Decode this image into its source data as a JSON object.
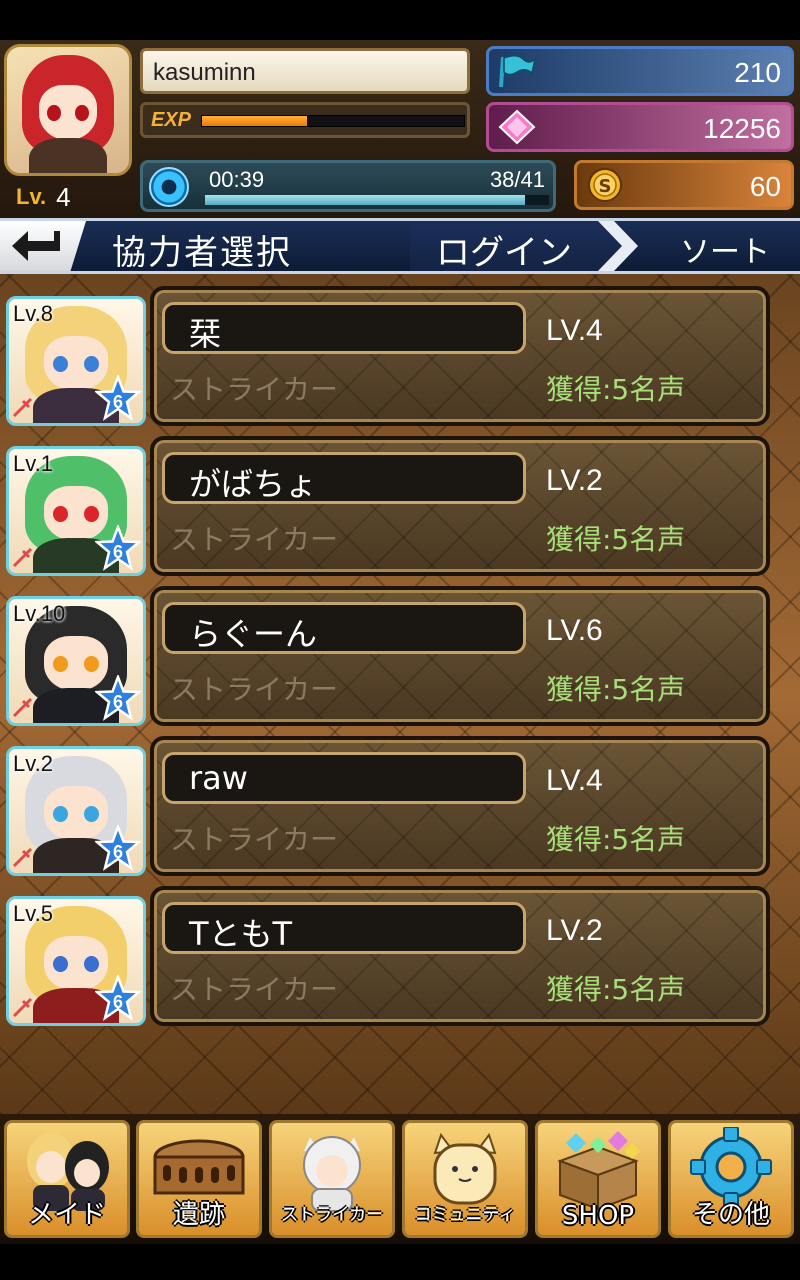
{
  "player": {
    "name": "kasuminn",
    "level_label": "Lv.",
    "level": "4",
    "exp_label": "EXP",
    "exp_fraction": 0.4,
    "stamina_timer": "00:39",
    "stamina_count": "38/41",
    "stamina_fraction": 0.93,
    "flags": "210",
    "gems": "12256",
    "coins": "60"
  },
  "titlebar": {
    "title": "協力者選択",
    "login_tab": "ログイン",
    "sort_button": "ソート"
  },
  "helpers": [
    {
      "thumb_level": "Lv.8",
      "rarity": "6",
      "name": "栞",
      "level": "LV.4",
      "class": "ストライカー",
      "reward": "獲得:5名声",
      "hair": "#f3d27a",
      "eye": "#3b7fd6",
      "outfit": "#3b2d3d"
    },
    {
      "thumb_level": "Lv.1",
      "rarity": "6",
      "name": "がばちょ",
      "level": "LV.2",
      "class": "ストライカー",
      "reward": "獲得:5名声",
      "hair": "#4fbf6a",
      "eye": "#d9262b",
      "outfit": "#263a26"
    },
    {
      "thumb_level": "Lv.10",
      "rarity": "6",
      "name": "らぐーん",
      "level": "LV.6",
      "class": "ストライカー",
      "reward": "獲得:5名声",
      "hair": "#2a2a2a",
      "eye": "#f19a1c",
      "outfit": "#1d1d24"
    },
    {
      "thumb_level": "Lv.2",
      "rarity": "6",
      "name": "raw",
      "level": "LV.4",
      "class": "ストライカー",
      "reward": "獲得:5名声",
      "hair": "#d9d9e0",
      "eye": "#3aa6e0",
      "outfit": "#2e2622"
    },
    {
      "thumb_level": "Lv.5",
      "rarity": "6",
      "name": "TともT",
      "level": "LV.2",
      "class": "ストライカー",
      "reward": "獲得:5名声",
      "hair": "#f2cf6a",
      "eye": "#3a6fd0",
      "outfit": "#8e1d1d"
    }
  ],
  "menu": [
    {
      "label": "メイド",
      "icon": "maid-icon"
    },
    {
      "label": "遺跡",
      "icon": "ruins-icon"
    },
    {
      "label": "ストライカー",
      "icon": "striker-icon"
    },
    {
      "label": "コミュニティ",
      "icon": "community-icon"
    },
    {
      "label": "SHOP",
      "icon": "shop-icon"
    },
    {
      "label": "その他",
      "icon": "settings-gear-icon"
    }
  ]
}
